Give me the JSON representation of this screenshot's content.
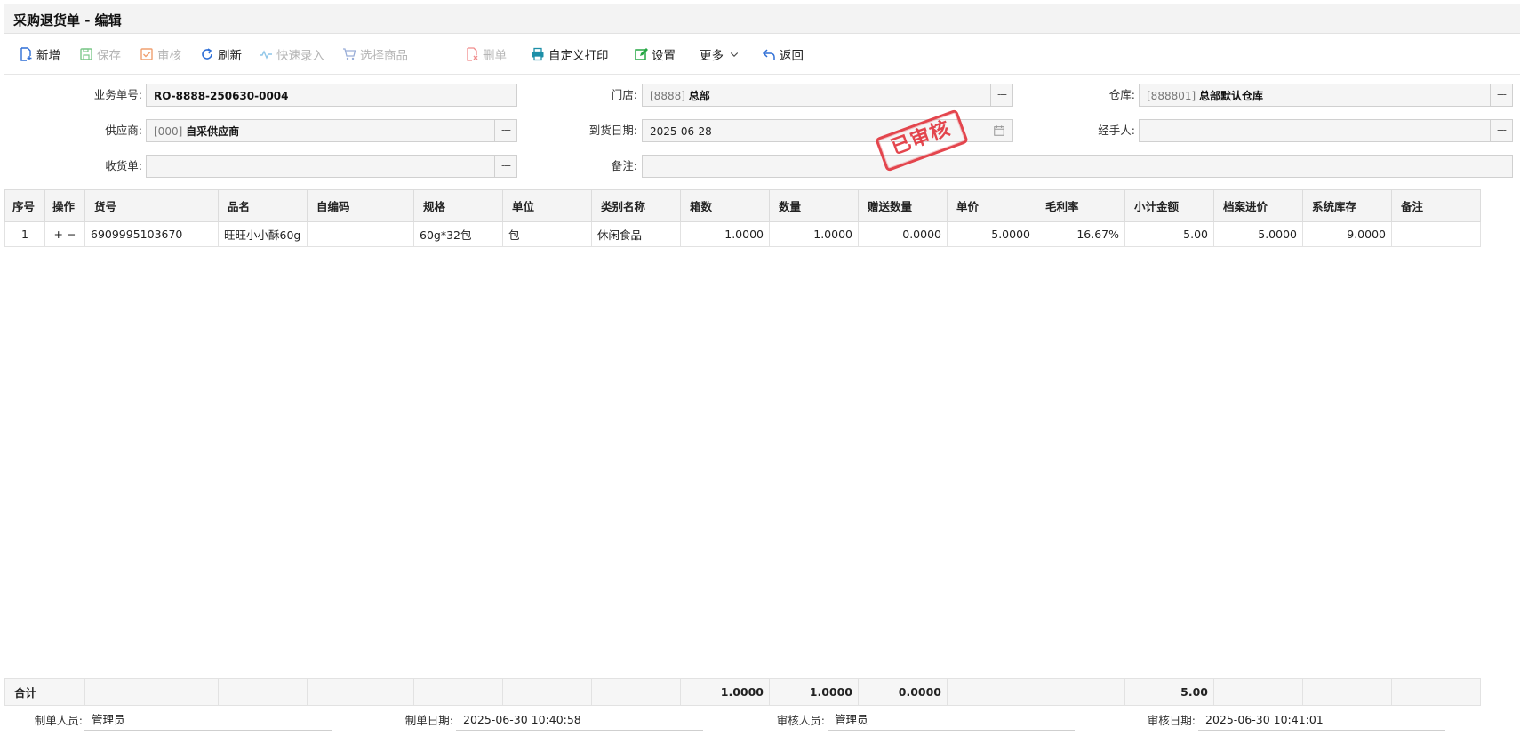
{
  "window": {
    "title": "采购退货单 - 编辑"
  },
  "toolbar": {
    "new": "新增",
    "save": "保存",
    "audit": "审核",
    "refresh": "刷新",
    "quick_entry": "快速录入",
    "select_goods": "选择商品",
    "delete": "删单",
    "custom_print": "自定义打印",
    "settings": "设置",
    "more": "更多",
    "back": "返回"
  },
  "form": {
    "doc_no": {
      "label": "业务单号:",
      "value": "RO-8888-250630-0004"
    },
    "store": {
      "label": "门店:",
      "code": "[8888]",
      "name": "总部"
    },
    "warehouse": {
      "label": "仓库:",
      "code": "[888801]",
      "name": "总部默认仓库"
    },
    "supplier": {
      "label": "供应商:",
      "code": "[000]",
      "name": "自采供应商"
    },
    "arrival_date": {
      "label": "到货日期:",
      "value": "2025-06-28"
    },
    "handler": {
      "label": "经手人:",
      "value": ""
    },
    "receipt": {
      "label": "收货单:",
      "value": ""
    },
    "remark": {
      "label": "备注:",
      "value": ""
    },
    "dots": "---",
    "stamp": "已审核"
  },
  "grid": {
    "columns": [
      "序号",
      "操作",
      "货号",
      "品名",
      "自编码",
      "规格",
      "单位",
      "类别名称",
      "箱数",
      "数量",
      "赠送数量",
      "单价",
      "毛利率",
      "小计金额",
      "档案进价",
      "系统库存",
      "备注"
    ],
    "rows": [
      {
        "seq": "1",
        "ops": "+ −",
        "sku": "6909995103670",
        "name": "旺旺小小酥60g",
        "self_code": "",
        "spec": "60g*32包",
        "unit": "包",
        "category": "休闲食品",
        "boxes": "1.0000",
        "qty": "1.0000",
        "gift_qty": "0.0000",
        "price": "5.0000",
        "margin": "16.67%",
        "subtotal": "5.00",
        "cost": "5.0000",
        "stock": "9.0000",
        "note": ""
      }
    ],
    "totals": {
      "label": "合计",
      "boxes": "1.0000",
      "qty": "1.0000",
      "gift_qty": "0.0000",
      "subtotal": "5.00"
    }
  },
  "footer": {
    "maker_label": "制单人员:",
    "maker": "管理员",
    "make_date_label": "制单日期:",
    "make_date": "2025-06-30 10:40:58",
    "auditor_label": "审核人员:",
    "auditor": "管理员",
    "audit_date_label": "审核日期:",
    "audit_date": "2025-06-30 10:41:01"
  },
  "colors": {
    "accent_blue": "#2f6fd6",
    "stamp_red": "#e2333b",
    "disabled": "#b5b5b5",
    "green": "#27a745"
  }
}
